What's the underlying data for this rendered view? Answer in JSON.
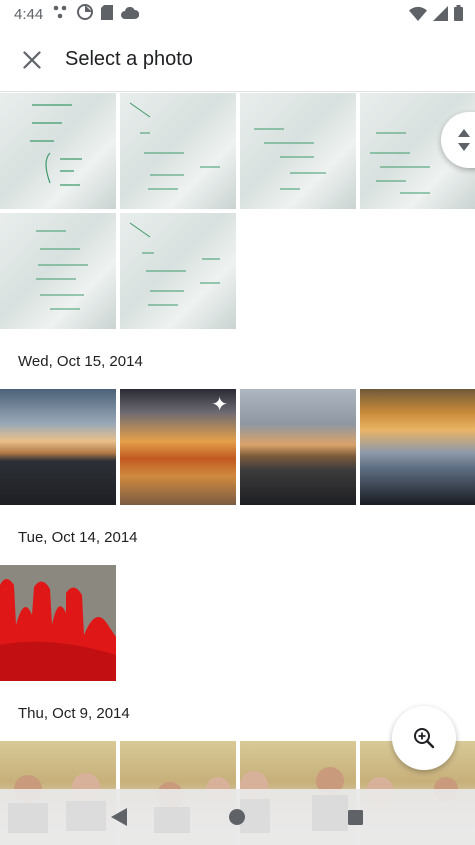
{
  "statusbar": {
    "time": "4:44"
  },
  "appbar": {
    "title": "Select a photo"
  },
  "sections": [
    {
      "date": "Wed, Oct 15, 2014"
    },
    {
      "date": "Tue, Oct 14, 2014"
    },
    {
      "date": "Thu, Oct 9, 2014"
    }
  ],
  "colors": {
    "accent": "#1a73e8",
    "ink": "#3c9a6a"
  }
}
